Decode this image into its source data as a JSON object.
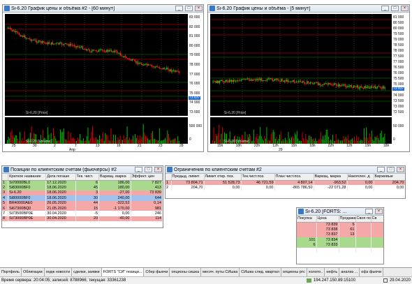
{
  "chart1": {
    "title": "Si-6.20 График цены и объёма #2 - [60 минут]",
    "price_ticks": [
      "83 000",
      "82 000",
      "81 000",
      "80 000",
      "79 000",
      "78 000",
      "77 000",
      "76 000",
      "75 000",
      "74 000",
      "73 000"
    ],
    "last_price": "73 837",
    "price_label": "Si-6.20 [Price]",
    "volume_label": "Si-6.20 [Volume]",
    "volume_ticks": [
      "500 000",
      "0"
    ],
    "date_ticks": [
      "25",
      "30",
      "2",
      "7",
      "13",
      "16",
      "21",
      "23",
      "28"
    ],
    "month": "Апр"
  },
  "chart2": {
    "title": "Si-6.20 График цены и объёма - [5 минут]",
    "price_ticks": [
      "81 000",
      "80 500",
      "80 000",
      "79 500",
      "79 000",
      "78 500",
      "78 000",
      "77 500",
      "77 000",
      "76 500",
      "76 000",
      "75 500",
      "75 000",
      "74 500",
      "74 000",
      "73 500",
      "73 000",
      "72 500"
    ],
    "last_price": "73 837",
    "price_label": "Si-6.20 [Price]",
    "volume_label": "Si-6.20 [Volume]",
    "volume_ticks": [
      "50 000",
      "0"
    ],
    "time_ticks": [
      "15h",
      "18h",
      "22h",
      "12h",
      "15h",
      "18h",
      "22h",
      "12h",
      "15h",
      "18h"
    ],
    "date_label": "29"
  },
  "positions": {
    "title": "Позиции по клиентским счетам (фьючерсы) #2",
    "columns": [
      "",
      "Краткое название",
      "Дата погаше",
      "Тек. чист.",
      "Вариац. марка",
      "Эффект. цен"
    ],
    "rows": [
      {
        "n": "1",
        "name": "Si70000BL0",
        "date": "17.12.2020",
        "qty": "6",
        "vm": "186,00",
        "eff": "7 827",
        "bg": "g"
      },
      {
        "n": "2",
        "name": "Si83000BF0",
        "date": "18.06.2020",
        "qty": "45",
        "vm": "180,00",
        "eff": "413",
        "bg": "g"
      },
      {
        "n": "3",
        "name": "Si-6.20",
        "date": "18.06.2020",
        "qty": "3",
        "vm": "-27,00",
        "eff": "73 839",
        "bg": "r"
      },
      {
        "n": "4",
        "name": "Si80000BF0",
        "date": "18.06.2020",
        "qty": "30",
        "vm": "240,00",
        "eff": "644",
        "bg": "sel"
      },
      {
        "n": "5",
        "name": "BR40000AE0",
        "date": "26.05.2020",
        "qty": "44",
        "vm": "-322,52",
        "eff": "0,14",
        "bg": "r"
      },
      {
        "n": "6",
        "name": "Si67300BQ0",
        "date": "21.05.2020",
        "qty": "15",
        "vm": "-1 170,00",
        "eff": "981",
        "bg": "r"
      },
      {
        "n": "7",
        "name": "Si73500BP0E",
        "date": "30.04.2020",
        "qty": "-5",
        "vm": "0,00",
        "eff": "246",
        "bg": "w"
      },
      {
        "n": "8",
        "name": "Si73000BP0E",
        "date": "30.04.2020",
        "qty": "20",
        "vm": "-40,00",
        "eff": "114",
        "bg": "r"
      }
    ]
  },
  "limits": {
    "title": "Ограничения по клиентским счетам #2",
    "columns": [
      "",
      "Предыд. лимит",
      "Лимит откр. поз.",
      "Тек.чист.поз.",
      "План чист.поз.",
      "Вариац. марка",
      "Накоплен. д",
      "Биржевые"
    ],
    "rows": [
      {
        "n": "1",
        "c": [
          "73 804,71",
          "51 528,73",
          "46 721,59",
          "4 807,14",
          "-963,52",
          "0,00",
          "204,70"
        ],
        "bg": "r"
      },
      {
        "n": "2",
        "c": [
          "204,70",
          "0,00",
          "0,00",
          "-865 786,50",
          "-22 071,28",
          "0,00",
          "0,00"
        ],
        "bg": "w"
      }
    ]
  },
  "orderbook": {
    "title": "Si-6.20 [FORTS: ...",
    "columns": [
      "Покупка",
      "Цена",
      "Продажа",
      "Своя по",
      "Св"
    ],
    "rows": [
      {
        "buy": "",
        "price": "73 839",
        "sell": "5",
        "bg": "r"
      },
      {
        "buy": "",
        "price": "73 838",
        "sell": "61",
        "bg": "r"
      },
      {
        "buy": "",
        "price": "73 837",
        "sell": "13",
        "bg": "r"
      },
      {
        "buy": "101",
        "price": "73 834",
        "sell": "",
        "bg": "g"
      },
      {
        "buy": "6",
        "price": "73 833",
        "sell": "",
        "bg": "g"
      },
      {
        "buy": "",
        "price": "",
        "sell": "",
        "bg": "w"
      }
    ]
  },
  "tabs": [
    "Портфель",
    "Облигации",
    "хедж новости",
    "сделки, заявки",
    "FORTS \"СИ\" позици...",
    "Сбер фьючи",
    "опционы сишка",
    "месяч. путы СИшка",
    "СИшка след. квартал",
    "опционы ртс",
    "холото..",
    "нефть",
    "анализ ...",
    "офз фьючи"
  ],
  "active_tab": 4,
  "status": {
    "server_time": "Время сервера: 20:04:05; записей: 8788966; текущая: 33361238",
    "ip": "194.247.150.89:15100",
    "date": "29.04.2020"
  },
  "colors": {
    "up": "#00d000",
    "down": "#ff2020",
    "volume_green": "#00c000",
    "volume_red": "#e00000",
    "accent": "#3b78c2"
  }
}
